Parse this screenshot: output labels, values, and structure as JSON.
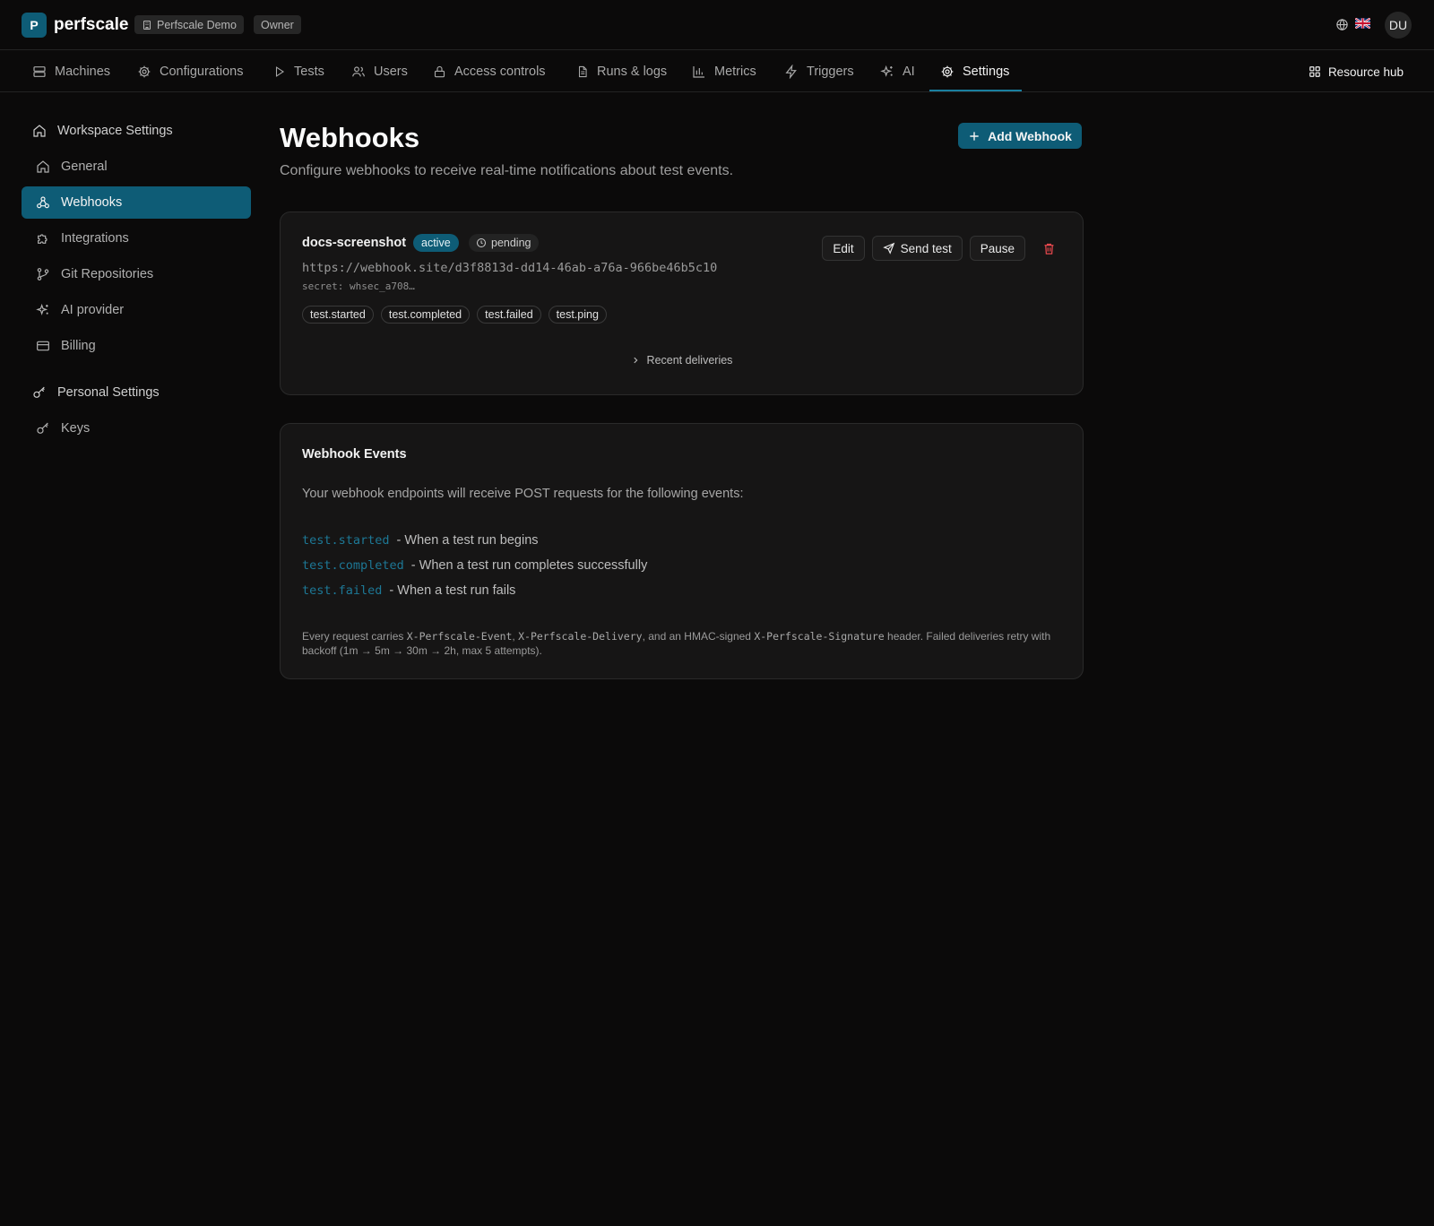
{
  "app": {
    "logo_letter": "P",
    "brand": "perfscale",
    "workspace": "Perfscale Demo",
    "role": "Owner",
    "avatar_initials": "DU",
    "accent_color": "#0e5c76"
  },
  "nav": {
    "items": [
      {
        "label": "Machines",
        "icon": "server-icon"
      },
      {
        "label": "Configurations",
        "icon": "gear-icon"
      },
      {
        "label": "Tests",
        "icon": "play-icon"
      },
      {
        "label": "Users",
        "icon": "users-icon"
      },
      {
        "label": "Access controls",
        "icon": "lock-icon"
      },
      {
        "label": "Runs & logs",
        "icon": "document-icon"
      },
      {
        "label": "Metrics",
        "icon": "bar-chart-icon"
      },
      {
        "label": "Triggers",
        "icon": "lightning-icon"
      },
      {
        "label": "AI",
        "icon": "sparkles-icon"
      },
      {
        "label": "Settings",
        "icon": "gear-icon"
      }
    ],
    "active": "Settings",
    "resource_hub": "Resource hub"
  },
  "sidebar": {
    "workspace_heading": "Workspace Settings",
    "items": [
      {
        "label": "General",
        "icon": "home-icon"
      },
      {
        "label": "Webhooks",
        "icon": "webhook-icon"
      },
      {
        "label": "Integrations",
        "icon": "puzzle-icon"
      },
      {
        "label": "Git Repositories",
        "icon": "git-branch-icon"
      },
      {
        "label": "AI provider",
        "icon": "sparkles-icon"
      },
      {
        "label": "Billing",
        "icon": "credit-card-icon"
      }
    ],
    "active": "Webhooks",
    "personal_heading": "Personal Settings",
    "personal_items": [
      {
        "label": "Keys",
        "icon": "key-icon"
      }
    ]
  },
  "page": {
    "title": "Webhooks",
    "subtitle": "Configure webhooks to receive real-time notifications about test events.",
    "add_button": "Add Webhook"
  },
  "webhook": {
    "name": "docs-screenshot",
    "status": "active",
    "delivery_state": "pending",
    "url": "https://webhook.site/d3f8813d-dd14-46ab-a76a-966be46b5c10",
    "secret": "secret: whsec_a708…",
    "events": [
      "test.started",
      "test.completed",
      "test.failed",
      "test.ping"
    ],
    "actions": {
      "edit": "Edit",
      "send_test": "Send test",
      "pause": "Pause"
    },
    "recent_deliveries": "Recent deliveries"
  },
  "events_card": {
    "title": "Webhook Events",
    "intro": "Your webhook endpoints will receive POST requests for the following events:",
    "events": [
      {
        "code": "test.started",
        "desc": "- When a test run begins"
      },
      {
        "code": "test.completed",
        "desc": "- When a test run completes successfully"
      },
      {
        "code": "test.failed",
        "desc": "- When a test run fails"
      }
    ],
    "note": {
      "t1": "Every request carries ",
      "h1": "X-Perfscale-Event",
      "t2": ", ",
      "h2": "X-Perfscale-Delivery",
      "t3": ", and an HMAC-signed ",
      "h3": "X-Perfscale-Signature",
      "t4": " header. Failed deliveries retry with backoff (1m → 5m → 30m → 2h, max 5 attempts)."
    }
  }
}
